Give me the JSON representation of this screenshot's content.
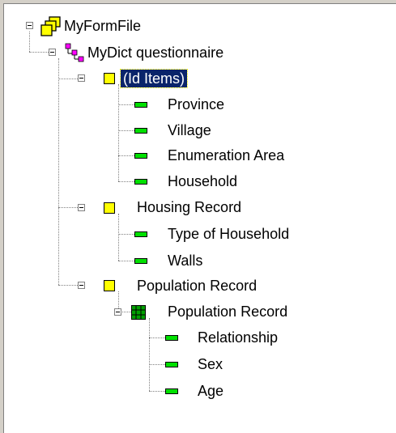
{
  "tree": {
    "root": {
      "label": "MyFormFile",
      "icon": "form-file-icon"
    },
    "dictionary": {
      "label": "MyDict questionnaire",
      "icon": "dictionary-icon"
    },
    "records": [
      {
        "label": "(Id Items)",
        "selected": true,
        "icon": "record-icon",
        "items": [
          {
            "label": "Province"
          },
          {
            "label": "Village"
          },
          {
            "label": "Enumeration Area"
          },
          {
            "label": "Household"
          }
        ]
      },
      {
        "label": "Housing Record",
        "selected": false,
        "icon": "record-icon",
        "items": [
          {
            "label": "Type of Household"
          },
          {
            "label": "Walls"
          }
        ]
      },
      {
        "label": "Population Record",
        "selected": false,
        "icon": "record-icon",
        "roster": {
          "label": "Population Record",
          "icon": "roster-grid-icon",
          "items": [
            {
              "label": "Relationship"
            },
            {
              "label": "Sex"
            },
            {
              "label": "Age"
            }
          ]
        }
      }
    ]
  },
  "colors": {
    "selection_bg": "#0a246a",
    "selection_text": "#ffffff",
    "record_icon": "#ffff00",
    "item_icon": "#00e000",
    "roster_icon": "#00a000",
    "dict_icon_pink": "#ff00ff",
    "tree_line": "#808080"
  }
}
